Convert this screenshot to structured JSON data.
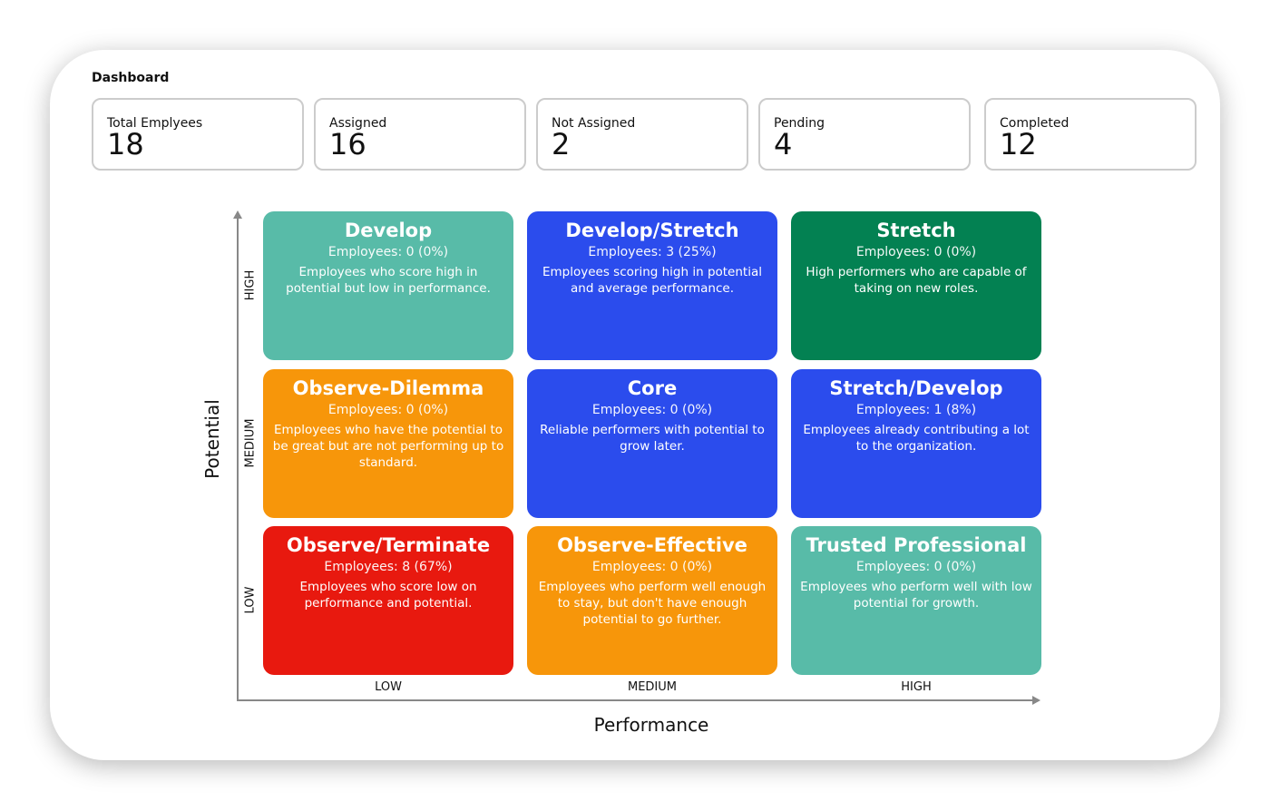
{
  "header": {
    "title": "Dashboard"
  },
  "stats": [
    {
      "label": "Total Emplyees",
      "value": "18"
    },
    {
      "label": "Assigned",
      "value": "16"
    },
    {
      "label": "Not Assigned",
      "value": "2"
    },
    {
      "label": "Pending",
      "value": "4"
    },
    {
      "label": "Completed",
      "value": "12"
    }
  ],
  "matrix": {
    "y_axis": "Potential",
    "x_axis": "Performance",
    "y_levels": [
      "HIGH",
      "MEDIUM",
      "LOW"
    ],
    "x_levels": [
      "LOW",
      "MEDIUM",
      "HIGH"
    ],
    "cells": [
      {
        "title": "Develop",
        "count": "Employees: 0 (0%)",
        "desc": "Employees who score high in potential but low in performance.",
        "color": "#58bba8"
      },
      {
        "title": "Develop/Stretch",
        "count": "Employees: 3 (25%)",
        "desc": "Employees scoring high in potential and average performance.",
        "color": "#2b4ced"
      },
      {
        "title": "Stretch",
        "count": "Employees: 0 (0%)",
        "desc": "High performers who are capable of taking on new roles.",
        "color": "#038152"
      },
      {
        "title": "Observe-Dilemma",
        "count": "Employees: 0 (0%)",
        "desc": "Employees who have the potential to be great but are not performing up to standard.",
        "color": "#f7960a"
      },
      {
        "title": "Core",
        "count": "Employees: 0 (0%)",
        "desc": "Reliable performers with potential to grow later.",
        "color": "#2b4ced"
      },
      {
        "title": "Stretch/Develop",
        "count": "Employees: 1 (8%)",
        "desc": "Employees already contributing a lot to the organization.",
        "color": "#2b4ced"
      },
      {
        "title": "Observe/Terminate",
        "count": "Employees: 8 (67%)",
        "desc": "Employees who score low on performance and potential.",
        "color": "#e8190f"
      },
      {
        "title": "Observe-Effective",
        "count": "Employees: 0 (0%)",
        "desc": "Employees who perform well enough to stay, but don't have enough potential to go further.",
        "color": "#f7960a"
      },
      {
        "title": "Trusted Professional",
        "count": "Employees: 0 (0%)",
        "desc": "Employees who perform well with low potential for growth.",
        "color": "#58bba8"
      }
    ]
  }
}
